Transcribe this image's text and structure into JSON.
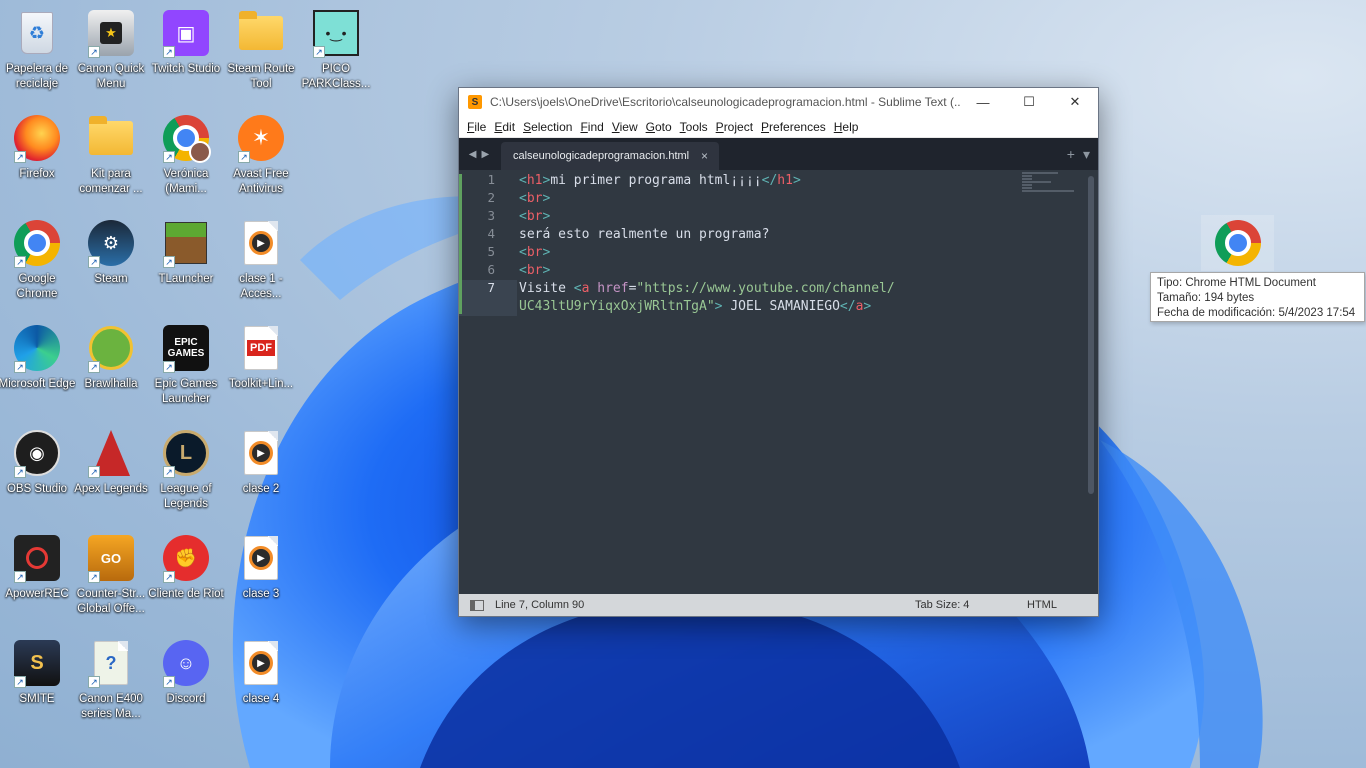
{
  "desktop": {
    "icons": [
      {
        "label": "Papelera de reciclaje",
        "icon": "recycle-bin-icon"
      },
      {
        "label": "Canon Quick Menu",
        "icon": "canon-quick-menu-icon"
      },
      {
        "label": "Twitch Studio",
        "icon": "twitch-icon"
      },
      {
        "label": "Steam Route Tool",
        "icon": "folder-icon"
      },
      {
        "label": "PICO PARKClass...",
        "icon": "pico-park-icon"
      },
      {
        "label": "Firefox",
        "icon": "firefox-icon"
      },
      {
        "label": "Kit para comenzar ...",
        "icon": "folder-icon"
      },
      {
        "label": "Verónica (Mami...",
        "icon": "chrome-profile-icon"
      },
      {
        "label": "Avast Free Antivirus",
        "icon": "avast-icon"
      },
      {
        "label": "Google Chrome",
        "icon": "chrome-icon"
      },
      {
        "label": "Steam",
        "icon": "steam-icon"
      },
      {
        "label": "TLauncher",
        "icon": "minecraft-icon"
      },
      {
        "label": "clase 1 - Acces...",
        "icon": "video-file-icon"
      },
      {
        "label": "Microsoft Edge",
        "icon": "edge-icon"
      },
      {
        "label": "Brawlhalla",
        "icon": "brawlhalla-icon"
      },
      {
        "label": "Epic Games Launcher",
        "icon": "epic-games-icon"
      },
      {
        "label": "Toolkit+Lin...",
        "icon": "pdf-file-icon"
      },
      {
        "label": "OBS Studio",
        "icon": "obs-icon"
      },
      {
        "label": "Apex Legends",
        "icon": "apex-icon"
      },
      {
        "label": "League of Legends",
        "icon": "league-icon"
      },
      {
        "label": "clase 2",
        "icon": "video-file-icon"
      },
      {
        "label": "ApowerREC",
        "icon": "apowerrec-icon"
      },
      {
        "label": "Counter-Str... Global Offe...",
        "icon": "csgo-icon"
      },
      {
        "label": "Cliente de Riot",
        "icon": "riot-icon"
      },
      {
        "label": "clase 3",
        "icon": "video-file-icon"
      },
      {
        "label": "SMITE",
        "icon": "smite-icon"
      },
      {
        "label": "Canon E400 series Ma...",
        "icon": "canon-manual-icon"
      },
      {
        "label": "Discord",
        "icon": "discord-icon"
      },
      {
        "label": "clase 4",
        "icon": "video-file-icon"
      }
    ],
    "dragged_icon": "chrome-html-file-icon",
    "tooltip": {
      "type": "Tipo: Chrome HTML Document",
      "size": "Tamaño: 194 bytes",
      "modified": "Fecha de modificación: 5/4/2023 17:54"
    }
  },
  "editor": {
    "title": "C:\\Users\\joels\\OneDrive\\Escritorio\\calseunologicadeprogramacion.html - Sublime Text (...",
    "window_controls": {
      "minimize": "—",
      "maximize": "☐",
      "close": "✕"
    },
    "menu": [
      "File",
      "Edit",
      "Selection",
      "Find",
      "View",
      "Goto",
      "Tools",
      "Project",
      "Preferences",
      "Help"
    ],
    "tab": {
      "label": "calseunologicadeprogramacion.html",
      "close": "×"
    },
    "tab_add": "+",
    "tab_menu": "▾",
    "line_numbers": [
      "1",
      "2",
      "3",
      "4",
      "5",
      "6",
      "7"
    ],
    "code": {
      "l1": {
        "o1": "<",
        "t1": "h1",
        "c1": ">",
        "text": "mi primer programa html¡¡¡¡",
        "o2": "</",
        "t2": "h1",
        "c2": ">"
      },
      "l2": {
        "o": "<",
        "t": "br",
        "c": ">"
      },
      "l3": {
        "o": "<",
        "t": "br",
        "c": ">"
      },
      "l4": {
        "text": "será esto realmente un programa?"
      },
      "l5": {
        "o": "<",
        "t": "br",
        "c": ">"
      },
      "l6": {
        "o": "<",
        "t": "br",
        "c": ">"
      },
      "l7": {
        "text1": "Visite ",
        "o1": "<",
        "t1": "a",
        "attr": " href",
        "eq": "=",
        "str1": "\"https://www.youtube.com/channel/"
      },
      "l7b": {
        "str2": "UC43ltU9rYiqxOxjWRltnTgA\"",
        "c1": ">",
        "text": " JOEL SAMANIEGO",
        "o2": "</",
        "t2": "a",
        "c2": ">"
      }
    },
    "status": {
      "position": "Line 7, Column 90",
      "tab_size": "Tab Size: 4",
      "syntax": "HTML"
    }
  }
}
